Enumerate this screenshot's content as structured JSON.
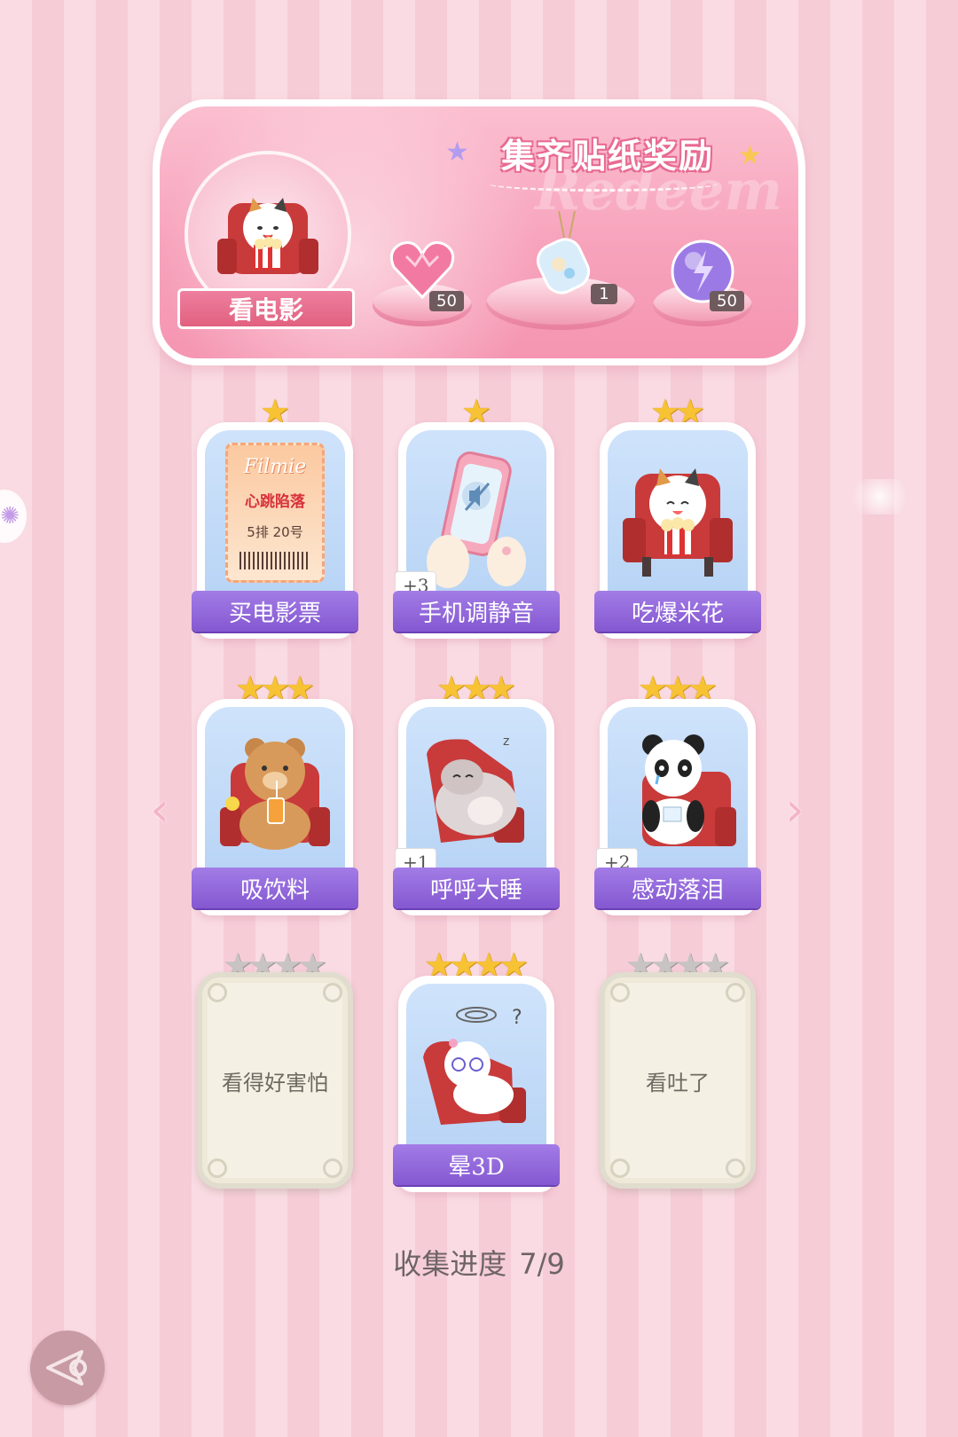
{
  "header": {
    "title": "集齐贴纸奖励",
    "watermark": "Redeem",
    "theme_label": "看电影",
    "rewards": [
      {
        "icon": "heart-gem-icon",
        "count": "50"
      },
      {
        "icon": "wish-bottle-icon",
        "count": "1"
      },
      {
        "icon": "energy-orb-icon",
        "count": "50"
      }
    ]
  },
  "stickers": [
    {
      "label": "买电影票",
      "stars": 1,
      "max_stars": 1,
      "bonus": "",
      "unlocked": true,
      "art": "ticket",
      "ticket_brand": "Filmie",
      "ticket_title": "心跳陷落",
      "ticket_seat": "5排 20号"
    },
    {
      "label": "手机调静音",
      "stars": 1,
      "max_stars": 1,
      "bonus": "+3",
      "unlocked": true,
      "art": "phone"
    },
    {
      "label": "吃爆米花",
      "stars": 2,
      "max_stars": 2,
      "bonus": "",
      "unlocked": true,
      "art": "popcorn-cat"
    },
    {
      "label": "吸饮料",
      "stars": 3,
      "max_stars": 3,
      "bonus": "",
      "unlocked": true,
      "art": "bear"
    },
    {
      "label": "呼呼大睡",
      "stars": 3,
      "max_stars": 3,
      "bonus": "+1",
      "unlocked": true,
      "art": "hamster"
    },
    {
      "label": "感动落泪",
      "stars": 3,
      "max_stars": 3,
      "bonus": "+2",
      "unlocked": true,
      "art": "panda"
    },
    {
      "label": "看得好害怕",
      "stars": 0,
      "max_stars": 4,
      "bonus": "",
      "unlocked": false,
      "art": "locked"
    },
    {
      "label": "晕3D",
      "stars": 4,
      "max_stars": 4,
      "bonus": "",
      "unlocked": true,
      "art": "dizzy-cat"
    },
    {
      "label": "看吐了",
      "stars": 0,
      "max_stars": 4,
      "bonus": "",
      "unlocked": false,
      "art": "locked"
    }
  ],
  "progress": {
    "label": "收集进度",
    "value": "7/9"
  },
  "colors": {
    "label_purple": "#8458d1",
    "star_gold": "#f7c334",
    "star_gray": "#c9c4c4",
    "banner_pink": "#f7a3bc"
  }
}
